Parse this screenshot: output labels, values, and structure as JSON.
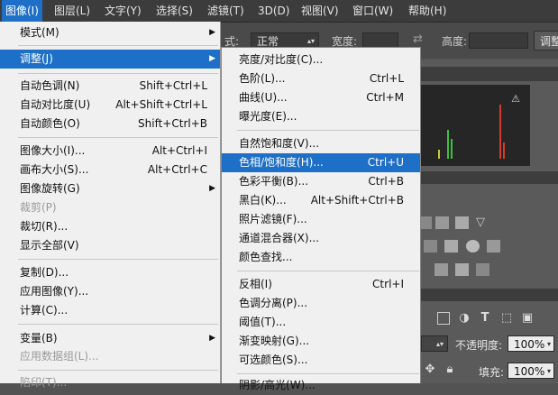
{
  "menubar": [
    {
      "label": "图像(I)",
      "active": true
    },
    {
      "label": "图层(L)"
    },
    {
      "label": "文字(Y)"
    },
    {
      "label": "选择(S)"
    },
    {
      "label": "滤镜(T)"
    },
    {
      "label": "3D(D)"
    },
    {
      "label": "视图(V)"
    },
    {
      "label": "窗口(W)"
    },
    {
      "label": "帮助(H)"
    }
  ],
  "options": {
    "style_label": "式:",
    "style_value": "正常",
    "width_label": "宽度:",
    "height_label": "高度:",
    "adjust_button": "调整"
  },
  "image_menu": {
    "items": [
      {
        "label": "模式(M)",
        "shortcut": "",
        "submenu": true
      },
      {
        "label": "调整(J)",
        "shortcut": "",
        "submenu": true,
        "highlight": true
      },
      {
        "label": "自动色调(N)",
        "shortcut": "Shift+Ctrl+L"
      },
      {
        "label": "自动对比度(U)",
        "shortcut": "Alt+Shift+Ctrl+L"
      },
      {
        "label": "自动颜色(O)",
        "shortcut": "Shift+Ctrl+B"
      },
      {
        "label": "图像大小(I)...",
        "shortcut": "Alt+Ctrl+I"
      },
      {
        "label": "画布大小(S)...",
        "shortcut": "Alt+Ctrl+C"
      },
      {
        "label": "图像旋转(G)",
        "shortcut": "",
        "submenu": true
      },
      {
        "label": "裁剪(P)",
        "shortcut": "",
        "disabled": true
      },
      {
        "label": "裁切(R)...",
        "shortcut": ""
      },
      {
        "label": "显示全部(V)",
        "shortcut": ""
      },
      {
        "label": "复制(D)...",
        "shortcut": ""
      },
      {
        "label": "应用图像(Y)...",
        "shortcut": ""
      },
      {
        "label": "计算(C)...",
        "shortcut": ""
      },
      {
        "label": "变量(B)",
        "shortcut": "",
        "submenu": true
      },
      {
        "label": "应用数据组(L)...",
        "shortcut": "",
        "disabled": true
      },
      {
        "label": "陷印(T)...",
        "shortcut": "",
        "disabled": true
      }
    ]
  },
  "adjust_menu": {
    "items": [
      {
        "label": "亮度/对比度(C)...",
        "shortcut": ""
      },
      {
        "label": "色阶(L)...",
        "shortcut": "Ctrl+L"
      },
      {
        "label": "曲线(U)...",
        "shortcut": "Ctrl+M"
      },
      {
        "label": "曝光度(E)...",
        "shortcut": ""
      },
      {
        "label": "自然饱和度(V)...",
        "shortcut": ""
      },
      {
        "label": "色相/饱和度(H)...",
        "shortcut": "Ctrl+U",
        "highlight": true
      },
      {
        "label": "色彩平衡(B)...",
        "shortcut": "Ctrl+B"
      },
      {
        "label": "黑白(K)...",
        "shortcut": "Alt+Shift+Ctrl+B"
      },
      {
        "label": "照片滤镜(F)...",
        "shortcut": ""
      },
      {
        "label": "通道混合器(X)...",
        "shortcut": ""
      },
      {
        "label": "颜色查找...",
        "shortcut": ""
      },
      {
        "label": "反相(I)",
        "shortcut": "Ctrl+I"
      },
      {
        "label": "色调分离(P)...",
        "shortcut": ""
      },
      {
        "label": "阈值(T)...",
        "shortcut": ""
      },
      {
        "label": "渐变映射(G)...",
        "shortcut": ""
      },
      {
        "label": "可选颜色(S)...",
        "shortcut": ""
      },
      {
        "label": "阴影/高光(W)...",
        "shortcut": ""
      }
    ]
  },
  "layers": {
    "opacity_label": "不透明度:",
    "opacity_value": "100%",
    "fill_label": "填充:",
    "fill_value": "100%"
  },
  "icons": {
    "warning": "warning-icon",
    "menu_arrow": "▶"
  },
  "colors": {
    "highlight": "#1e6fc7",
    "menu_bg": "#f0f0f0",
    "menubar_bg": "#3c3c3c"
  }
}
